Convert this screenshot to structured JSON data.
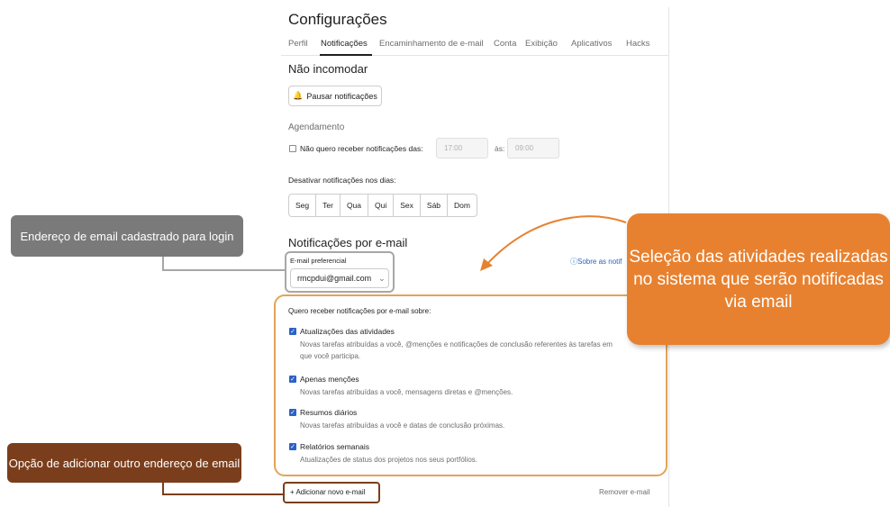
{
  "header": {
    "title": "Configurações",
    "tabs": [
      "Perfil",
      "Notificações",
      "Encaminhamento de e-mail",
      "Conta",
      "Exibição",
      "Aplicativos",
      "Hacks"
    ]
  },
  "dnd": {
    "heading": "Não incomodar",
    "pause_button": "Pausar notificações",
    "schedule_label": "Agendamento",
    "schedule_checkbox_label": "Não quero receber notificações das:",
    "from_time": "17:00",
    "to_label": "às:",
    "to_time": "09:00",
    "days_label": "Desativar notificações nos dias:",
    "days": [
      "Seg",
      "Ter",
      "Qua",
      "Qui",
      "Sex",
      "Sáb",
      "Dom"
    ]
  },
  "email": {
    "heading": "Notificações por e-mail",
    "preferred_label": "E-mail preferencial",
    "preferred_value": "rmcpdui@gmail.com",
    "about_link": "Sobre as notif",
    "intro": "Quero receber notificações por e-mail sobre:",
    "options": [
      {
        "title": "Atualizações das atividades",
        "desc": "Novas tarefas atribuídas a você, @menções e notificações de conclusão referentes às tarefas em",
        "desc2": "que você participa."
      },
      {
        "title": "Apenas menções",
        "desc": "Novas tarefas atribuídas a você, mensagens diretas e @menções."
      },
      {
        "title": "Resumos diários",
        "desc": "Novas tarefas atribuídas a você e datas de conclusão próximas."
      },
      {
        "title": "Relatórios semanais",
        "desc": "Atualizações de status dos projetos nos seus portfólios."
      }
    ],
    "add_email": "+ Adicionar novo e-mail",
    "remove_email": "Remover e-mail"
  },
  "annotations": {
    "login_email": "Endereço de email cadastrado para login",
    "activities": "Seleção das atividades realizadas no sistema que serão notificadas via email",
    "add_email": "Opção de adicionar outro endereço de email"
  },
  "colors": {
    "annotation_gray": "#7a7a7a",
    "annotation_orange": "#e8812f",
    "annotation_brown": "#7b3e1c",
    "checkbox_blue": "#2b62c5"
  }
}
